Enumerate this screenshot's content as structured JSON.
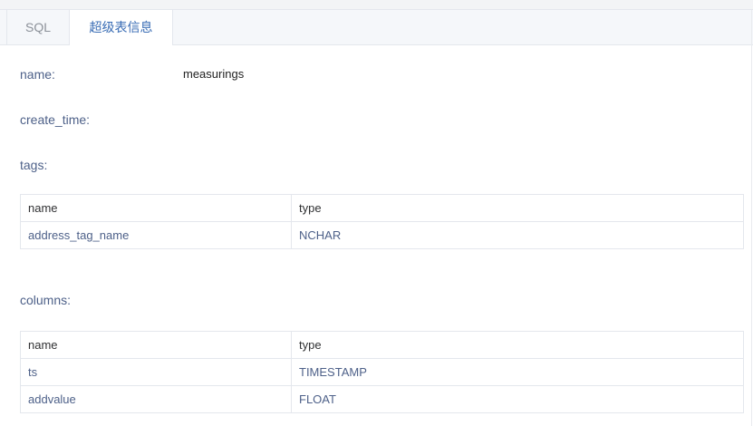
{
  "tabs": {
    "sql_label": "SQL",
    "info_label": "超级表信息",
    "active_index": 1
  },
  "fields": {
    "name_label": "name:",
    "name_value": "measurings",
    "create_time_label": "create_time:",
    "tags_label": "tags:",
    "columns_label": "columns:"
  },
  "tags_table": {
    "headers": [
      "name",
      "type"
    ],
    "rows": [
      [
        "address_tag_name",
        "NCHAR"
      ]
    ]
  },
  "columns_table": {
    "headers": [
      "name",
      "type"
    ],
    "rows": [
      [
        "ts",
        "TIMESTAMP"
      ],
      [
        "addvalue",
        "FLOAT"
      ]
    ]
  },
  "colors": {
    "label": "#4e6189",
    "cell_text": "#4e6189",
    "header_text": "#303133",
    "active_tab_text": "#3a6db5",
    "inactive_tab_text": "#8c9199",
    "border": "#e4e7ed",
    "tab_bar_bg": "#f5f7fa"
  }
}
